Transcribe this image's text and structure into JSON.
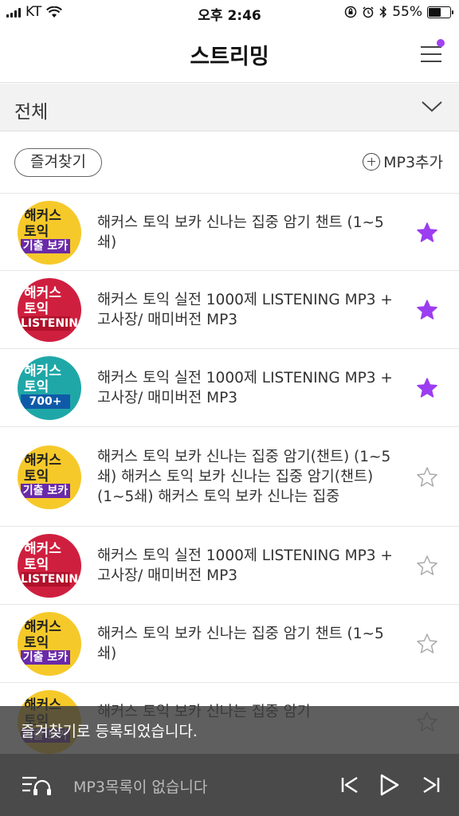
{
  "status_bar": {
    "carrier": "KT",
    "time": "오후 2:46",
    "battery": "55%",
    "battery_level": 0.55
  },
  "header": {
    "title": "스트리밍"
  },
  "filter": {
    "label": "전체"
  },
  "actions": {
    "favorites_label": "즐겨찾기",
    "add_mp3_label": "MP3추가"
  },
  "list": [
    {
      "title": "해커스 토익 보카 신나는 집중 암기 챈트 (1~5쇄)",
      "favorited": true,
      "cover": "vocab"
    },
    {
      "title": "해커스 토익 실전 1000제 LISTENING MP3 + 고사장/ 매미버전 MP3",
      "favorited": true,
      "cover": "listening"
    },
    {
      "title": "해커스 토익 실전 1000제 LISTENING MP3 + 고사장/ 매미버전 MP3",
      "favorited": true,
      "cover": "teal"
    },
    {
      "title": "해커스 토익 보카 신나는 집중 암기(챈트) (1~5쇄) 해커스 토익 보카 신나는 집중 암기(챈트) (1~5쇄) 해커스 토익 보카 신나는 집중",
      "favorited": false,
      "cover": "vocab"
    },
    {
      "title": "해커스 토익 실전 1000제 LISTENING MP3 + 고사장/ 매미버전 MP3",
      "favorited": false,
      "cover": "listening"
    },
    {
      "title": "해커스 토익 보카 신나는 집중 암기 챈트 (1~5쇄)",
      "favorited": false,
      "cover": "vocab"
    },
    {
      "title": "해커스 토익 보카 신나는 집중 암기",
      "favorited": false,
      "cover": "vocab"
    }
  ],
  "covers": {
    "vocab": {
      "line1": "해커스",
      "line2": "토익",
      "band": "기출 보카"
    },
    "listening": {
      "line1": "해커스",
      "line2": "토익",
      "band": "LISTENING"
    },
    "teal": {
      "line1": "해커스",
      "line2": "토익",
      "band": "700+"
    }
  },
  "toast": {
    "message": "즐겨찾기로 등록되었습니다."
  },
  "player": {
    "status_text": "MP3목록이 없습니다"
  },
  "colors": {
    "accent": "#9b3df0",
    "star_filled": "#9b3df0",
    "player_bg": "#4a4a4a",
    "cover_yellow": "#f6c92a",
    "cover_red": "#cf1f3f",
    "cover_teal": "#1fa7a8"
  }
}
